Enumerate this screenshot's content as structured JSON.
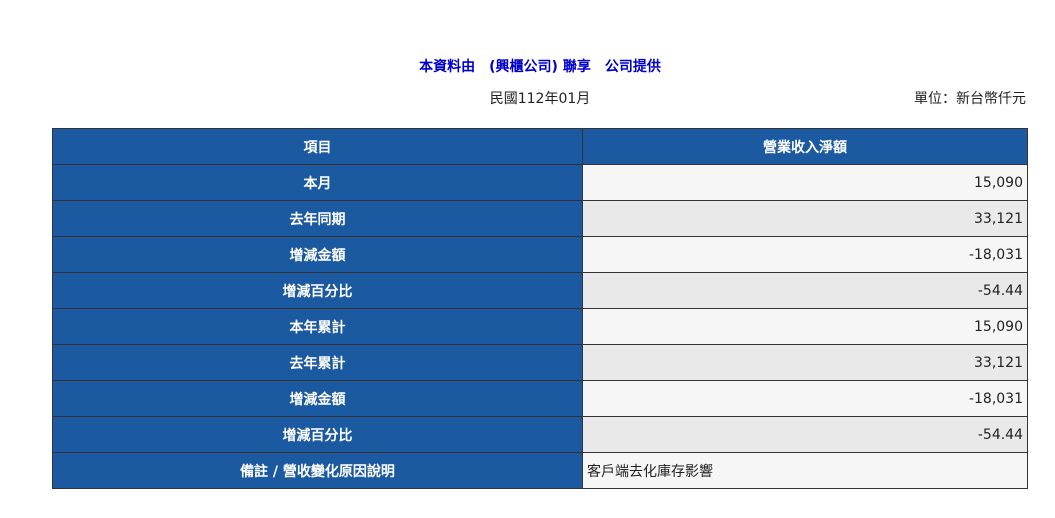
{
  "header": {
    "title": "本資料由　(興櫃公司) 聯享　公司提供",
    "date": "民國112年01月",
    "unit": "單位：新台幣仟元"
  },
  "table": {
    "columns": [
      "項目",
      "營業收入淨額"
    ],
    "rows": [
      {
        "label": "本月",
        "value": "15,090"
      },
      {
        "label": "去年同期",
        "value": "33,121"
      },
      {
        "label": "增減金額",
        "value": "-18,031"
      },
      {
        "label": "增減百分比",
        "value": "-54.44"
      },
      {
        "label": "本年累計",
        "value": "15,090"
      },
      {
        "label": "去年累計",
        "value": "33,121"
      },
      {
        "label": "增減金額",
        "value": "-18,031"
      },
      {
        "label": "增減百分比",
        "value": "-54.44"
      },
      {
        "label": "備註 / 營收變化原因說明",
        "value": "客戶端去化庫存影響"
      }
    ]
  },
  "colors": {
    "header_blue": "#1b5aa0",
    "title_blue": "#0000cc",
    "row_light": "#f6f6f6",
    "row_dark": "#e9e9e9"
  }
}
